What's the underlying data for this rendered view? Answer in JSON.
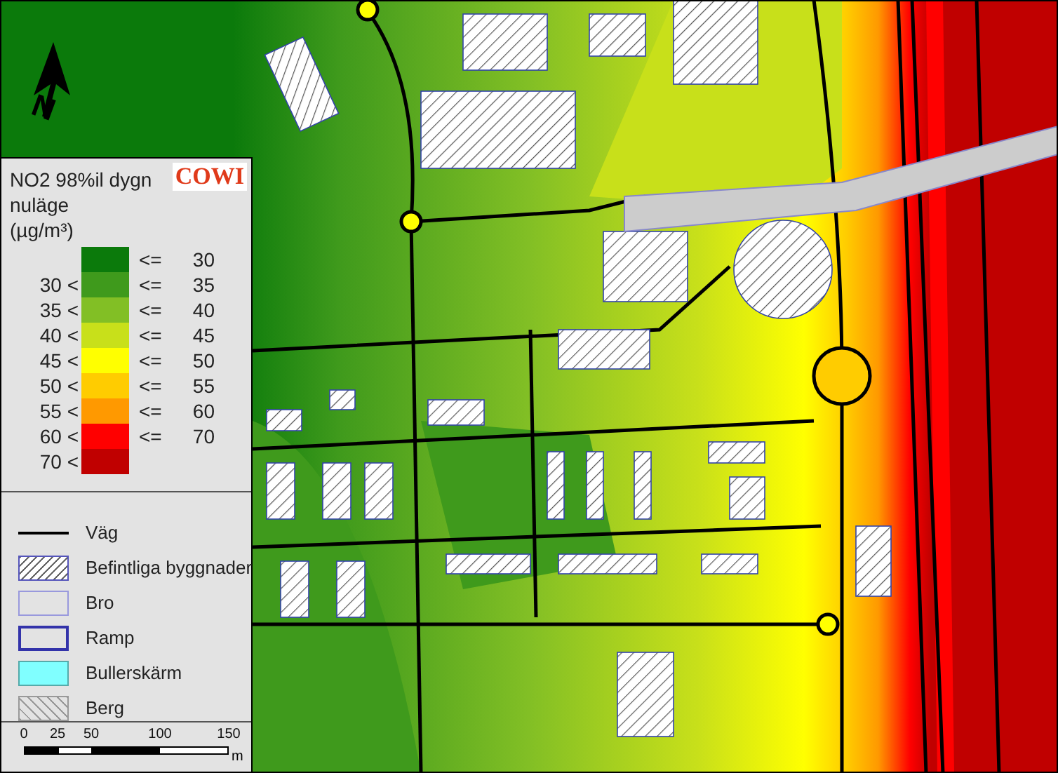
{
  "map": {
    "north_arrow": {
      "label": "N"
    }
  },
  "legend": {
    "logo": "COWI",
    "title": [
      "NO2 98%il dygn",
      "nuläge",
      "(µg/m³)"
    ],
    "classes": [
      {
        "upper": "30",
        "color": "#0b7a0b"
      },
      {
        "lower": "30 <",
        "upper": "35",
        "color": "#3f9a1c"
      },
      {
        "lower": "35 <",
        "upper": "40",
        "color": "#82bf25"
      },
      {
        "lower": "40 <",
        "upper": "45",
        "color": "#c8e01a"
      },
      {
        "lower": "45 <",
        "upper": "50",
        "color": "#ffff00"
      },
      {
        "lower": "50 <",
        "upper": "55",
        "color": "#ffcc00"
      },
      {
        "lower": "55 <",
        "upper": "60",
        "color": "#ff9900"
      },
      {
        "lower": "60 <",
        "upper": "70",
        "color": "#ff0000"
      },
      {
        "lower": "70 <",
        "color": "#c00000"
      }
    ],
    "upper_prefix": "<=",
    "items": [
      {
        "kind": "line",
        "label": "Väg"
      },
      {
        "kind": "hatch",
        "label": "Befintliga byggnader"
      },
      {
        "kind": "bridge",
        "label": "Bro"
      },
      {
        "kind": "ramp",
        "label": "Ramp"
      },
      {
        "kind": "screen",
        "label": "Bullerskärm"
      },
      {
        "kind": "rock",
        "label": "Berg"
      }
    ],
    "scale_bar": {
      "ticks": [
        "0",
        "25",
        "50",
        "100",
        "150"
      ],
      "unit": "m"
    }
  }
}
